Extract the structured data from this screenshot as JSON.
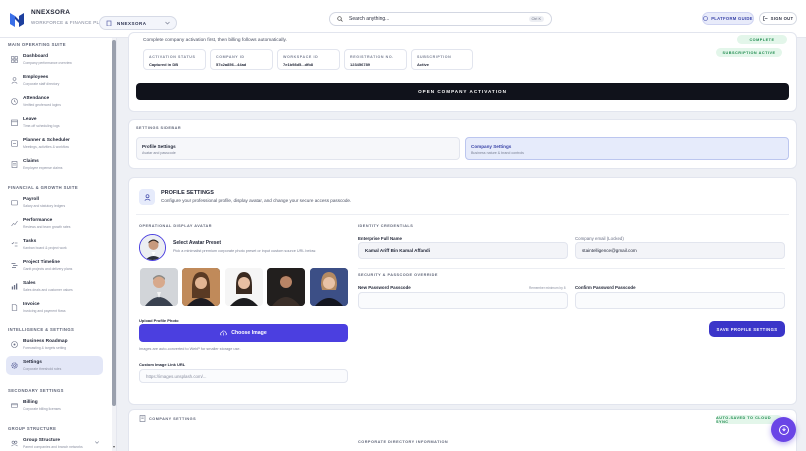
{
  "header": {
    "brand": "NNEXSORA",
    "brand_subtitle": "WORKFORCE & FINANCE PLATFORM",
    "org_selector": "NNEXSORA",
    "search_placeholder": "Search anything...",
    "search_shortcut": "Ctrl K",
    "platform_guide": "PLATFORM GUIDE",
    "sign_out": "SIGN OUT"
  },
  "sidebar": {
    "sections": [
      {
        "title": "MAIN OPERATING SUITE"
      },
      {
        "title": "FINANCIAL & GROWTH SUITE"
      },
      {
        "title": "INTELLIGENCE & SETTINGS"
      },
      {
        "title": "SECONDARY SETTINGS"
      },
      {
        "title": "GROUP STRUCTURE"
      }
    ],
    "items": [
      {
        "label": "Dashboard",
        "sub": "Company performance overview",
        "icon": "grid-icon"
      },
      {
        "label": "Employees",
        "sub": "Corporate staff directory",
        "icon": "users-icon"
      },
      {
        "label": "Attendance",
        "sub": "Verified geofenced logins",
        "icon": "clock-icon"
      },
      {
        "label": "Leave",
        "sub": "Time-off scheduling logs",
        "icon": "calendar-icon"
      },
      {
        "label": "Planner & Scheduler",
        "sub": "Meetings, activities & workflow",
        "icon": "planner-icon"
      },
      {
        "label": "Claims",
        "sub": "Employee expense claims",
        "icon": "receipt-icon"
      },
      {
        "label": "Payroll",
        "sub": "Salary and statutory ledgers",
        "icon": "wallet-icon"
      },
      {
        "label": "Performance",
        "sub": "Reviews and team growth rates",
        "icon": "chart-icon"
      },
      {
        "label": "Tasks",
        "sub": "Kanban board & project work",
        "icon": "tasks-icon"
      },
      {
        "label": "Project Timeline",
        "sub": "Gantt projects and delivery plans",
        "icon": "timeline-icon"
      },
      {
        "label": "Sales",
        "sub": "Sales deals and customer values",
        "icon": "sales-icon"
      },
      {
        "label": "Invoice",
        "sub": "Invoicing and payment flows",
        "icon": "invoice-icon"
      },
      {
        "label": "Business Roadmap",
        "sub": "Forecasting & targets setting",
        "icon": "roadmap-icon"
      },
      {
        "label": "Settings",
        "sub": "Corporate threshold rules",
        "icon": "gear-icon"
      },
      {
        "label": "Billing",
        "sub": "Corporate billing licenses",
        "icon": "billing-icon"
      },
      {
        "label": "Group Structure",
        "sub": "Parent companies and branch networks",
        "icon": "group-icon"
      }
    ]
  },
  "activation": {
    "instruction": "Complete company activation first, then billing follows automatically.",
    "status_complete": "COMPLETE",
    "status_subscription": "SUBSCRIPTION ACTIVE",
    "stats": [
      {
        "key": "ACTIVATION STATUS",
        "value": "Captured in DB"
      },
      {
        "key": "COMPANY ID",
        "value": "57c2a856...44ad"
      },
      {
        "key": "WORKSPACE ID",
        "value": "7e1b98d5...dfb8"
      },
      {
        "key": "REGISTRATION NO.",
        "value": "123456789"
      },
      {
        "key": "SUBSCRIPTION",
        "value": "Active"
      }
    ],
    "open_button": "OPEN COMPANY ACTIVATION"
  },
  "settings_sidebar": {
    "title": "SETTINGS SIDEBAR",
    "tabs": [
      {
        "label": "Profile Settings",
        "sub": "Avatar and passcode"
      },
      {
        "label": "Company Settings",
        "sub": "Business nature & brand controls"
      }
    ]
  },
  "profile": {
    "title": "PROFILE SETTINGS",
    "description": "Configure your professional profile, display avatar, and change your secure access passcode.",
    "avatar_section": "OPERATIONAL DISPLAY AVATAR",
    "avatar_preset_title": "Select Avatar Preset",
    "avatar_preset_desc": "Pick a minimalist premium corporate photo preset or input custom source URL below.",
    "upload_label": "Upload Profile Photo",
    "upload_button": "Choose Image",
    "upload_hint": "Images are auto-converted to WebP for smaller storage use.",
    "custom_url_label": "Custom Image Link URL",
    "custom_url_placeholder": "https://images.unsplash.com/...",
    "identity_section": "IDENTITY CREDENTIALS",
    "full_name_label": "Enterprise Full Name",
    "full_name_value": "Kamal Ariff Bin Kamal Affandi",
    "email_label": "Company email (Locked)",
    "email_value": "staintelligence@gmail.com",
    "security_section": "SECURITY & PASSCODE OVERRIDE",
    "new_pass_label": "New Password Passcode",
    "new_pass_hint": "Remember minimum by 8",
    "confirm_pass_label": "Confirm Password Passcode",
    "save_button": "SAVE PROFILE SETTINGS"
  },
  "company": {
    "title": "COMPANY SETTINGS",
    "autosave": "AUTO-SAVED TO CLOUD SYNC",
    "directory_section": "CORPORATE DIRECTORY INFORMATION"
  },
  "colors": {
    "accent": "#4b3fe0",
    "success": "#1d8a4d",
    "dark_button": "#10121b"
  }
}
